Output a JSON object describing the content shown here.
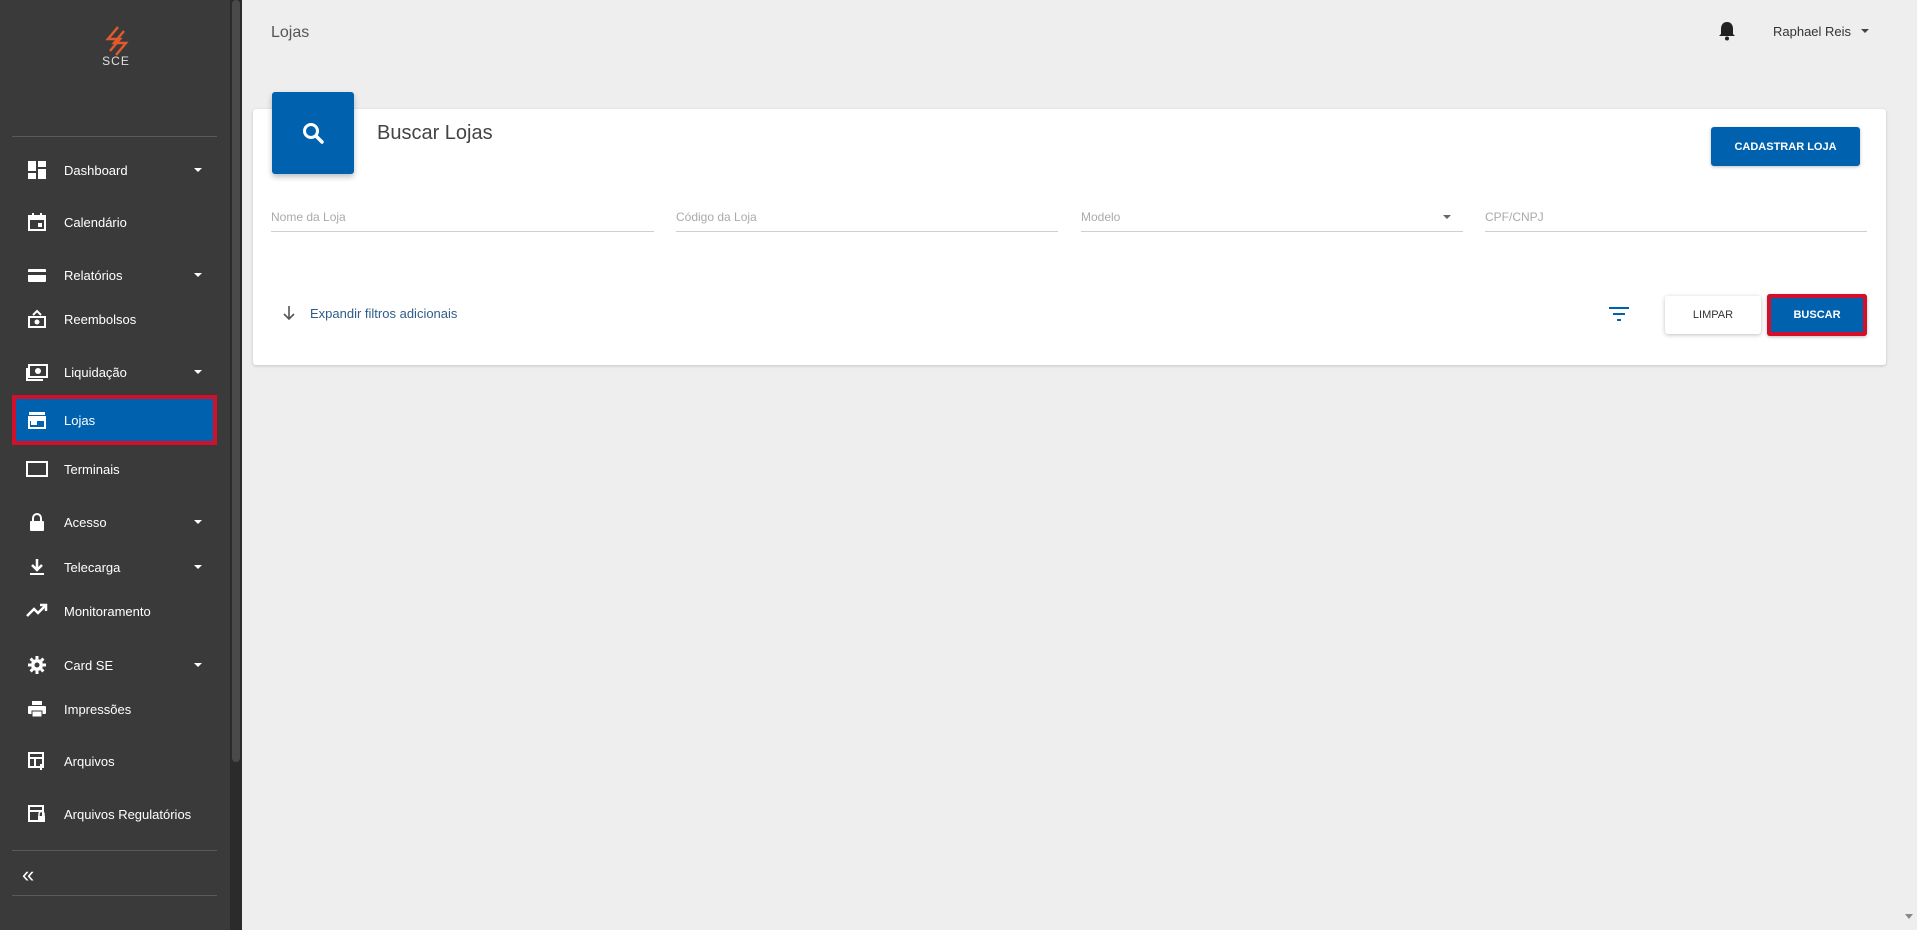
{
  "brand": {
    "logo_text": "SCE",
    "accent": "#0062ae",
    "highlight": "#d3102a"
  },
  "sidebar": {
    "items": [
      {
        "label": "Dashboard",
        "icon": "dashboard-icon",
        "has_submenu": true
      },
      {
        "label": "Calendário",
        "icon": "calendar-icon",
        "has_submenu": false
      },
      {
        "label": "Relatórios",
        "icon": "credit-card-icon",
        "has_submenu": true
      },
      {
        "label": "Reembolsos",
        "icon": "refund-icon",
        "has_submenu": false
      },
      {
        "label": "Liquidação",
        "icon": "money-icon",
        "has_submenu": true
      },
      {
        "label": "Lojas",
        "icon": "store-icon",
        "has_submenu": false,
        "active": true
      },
      {
        "label": "Terminais",
        "icon": "terminal-icon",
        "has_submenu": false
      },
      {
        "label": "Acesso",
        "icon": "lock-icon",
        "has_submenu": true
      },
      {
        "label": "Telecarga",
        "icon": "download-icon",
        "has_submenu": true
      },
      {
        "label": "Monitoramento",
        "icon": "trending-up-icon",
        "has_submenu": false
      },
      {
        "label": "Card SE",
        "icon": "gear-icon",
        "has_submenu": true
      },
      {
        "label": "Impressões",
        "icon": "printer-icon",
        "has_submenu": false
      },
      {
        "label": "Arquivos",
        "icon": "files-icon",
        "has_submenu": false
      },
      {
        "label": "Arquivos Regulatórios",
        "icon": "regulatory-files-icon",
        "has_submenu": false
      }
    ],
    "collapse_glyph": "«"
  },
  "header": {
    "title": "Lojas",
    "user_name": "Raphael Reis"
  },
  "search_card": {
    "title": "Buscar Lojas",
    "register_button": "CADASTRAR LOJA",
    "fields": {
      "store_name_placeholder": "Nome da Loja",
      "store_code_placeholder": "Código da Loja",
      "model_placeholder": "Modelo",
      "cpf_cnpj_placeholder": "CPF/CNPJ"
    },
    "expand_filters": "Expandir filtros adicionais",
    "clear_button": "LIMPAR",
    "search_button": "BUSCAR"
  }
}
